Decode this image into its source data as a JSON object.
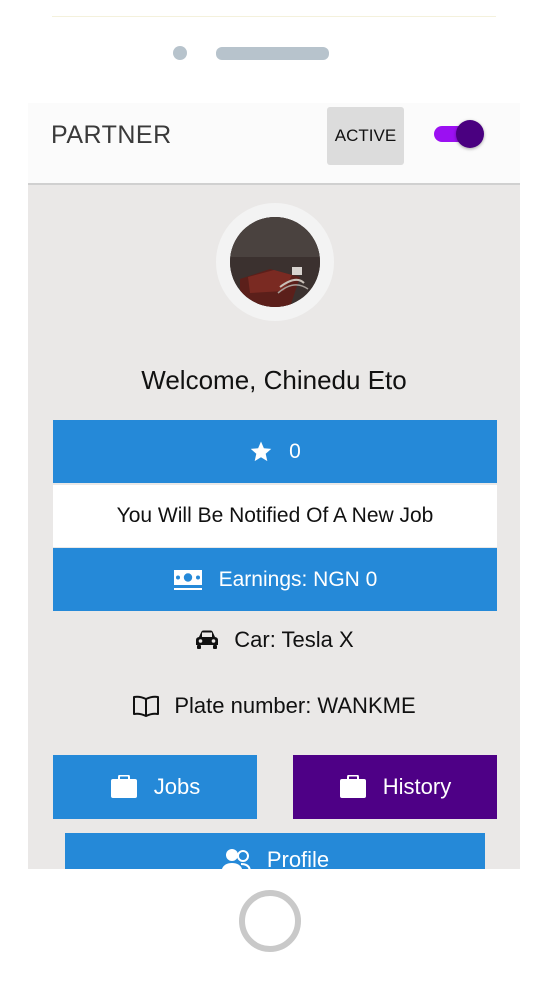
{
  "app": {
    "title": "PARTNER",
    "status_button_label": "ACTIVE",
    "status_toggle_on": true
  },
  "profile": {
    "welcome_text": "Welcome, Chinedu Eto",
    "rating_value": "0",
    "notification_text": "You Will Be Notified Of A New Job",
    "earnings_text": "Earnings: NGN 0",
    "car_text": "Car: Tesla X",
    "plate_text": "Plate number: WANKME"
  },
  "actions": {
    "jobs_label": "Jobs",
    "history_label": "History",
    "profile_label": "Profile"
  },
  "icons": {
    "rating": "star-icon",
    "earnings": "money-icon",
    "car": "car-icon",
    "plate": "book-icon",
    "jobs": "briefcase-icon",
    "history": "briefcase-icon",
    "profile": "users-icon"
  },
  "colors": {
    "primary_blue": "#2589d8",
    "history_purple": "#4e0086",
    "toggle_purple": "#9b10f2",
    "screen_bg": "#eae8e7"
  }
}
